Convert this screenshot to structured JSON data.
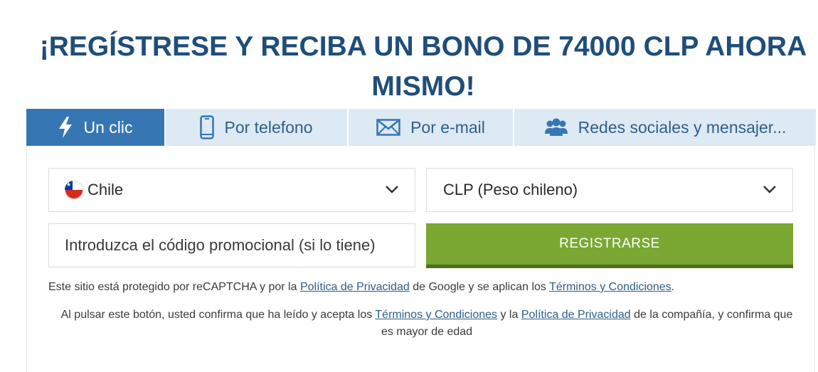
{
  "heading": "¡REGÍSTRESE Y RECIBA UN BONO DE 74000 CLP AHORA MISMO!",
  "tabs": [
    {
      "label": "Un clic",
      "icon": "lightning-icon",
      "active": true
    },
    {
      "label": "Por telefono",
      "icon": "phone-icon",
      "active": false
    },
    {
      "label": "Por e-mail",
      "icon": "envelope-icon",
      "active": false
    },
    {
      "label": "Redes sociales y mensajer...",
      "icon": "users-icon",
      "active": false
    }
  ],
  "country": {
    "value": "Chile",
    "flag": "chile-flag-icon"
  },
  "currency": {
    "value": "CLP (Peso chileno)"
  },
  "promo": {
    "placeholder": "Introduzca el código promocional (si lo tiene)"
  },
  "register_button": "REGISTRARSE",
  "recaptcha_note": {
    "prefix": "Este sitio está protegido por reCAPTCHA y por la ",
    "privacy_link": "Política de Privacidad",
    "middle": " de Google y se aplican los ",
    "terms_link": "Términos y Condiciones",
    "suffix": "."
  },
  "consent_note": {
    "prefix": "Al pulsar este botón, usted confirma que ha leído y acepta los ",
    "terms_link": "Términos y Condiciones",
    "middle": " y la ",
    "privacy_link": "Política de Privacidad",
    "suffix": " de la compañía, y confirma que es mayor de edad"
  },
  "colors": {
    "heading": "#1f4e7a",
    "tab_active": "#3676b3",
    "tab_inactive": "#dde9f3",
    "register": "#7aa832"
  }
}
